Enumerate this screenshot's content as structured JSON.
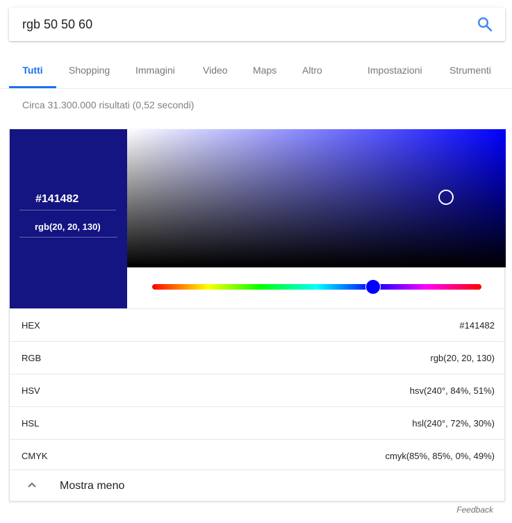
{
  "search": {
    "query": "rgb 50 50 60",
    "icon": "search-icon"
  },
  "tabs": [
    {
      "label": "Tutti",
      "active": true
    },
    {
      "label": "Shopping"
    },
    {
      "label": "Immagini"
    },
    {
      "label": "Video"
    },
    {
      "label": "Maps"
    },
    {
      "label": "Altro"
    },
    {
      "label": "Impostazioni"
    },
    {
      "label": "Strumenti"
    }
  ],
  "results_count": "Circa 31.300.000 risultati (0,52 secondi)",
  "picker": {
    "color": "#141482",
    "hex_display": "#141482",
    "rgb_display": "rgb(20, 20, 130)",
    "hue_color": "#0000ff",
    "hue_degrees": 240
  },
  "values": [
    {
      "key": "HEX",
      "value": "#141482"
    },
    {
      "key": "RGB",
      "value": "rgb(20, 20, 130)"
    },
    {
      "key": "HSV",
      "value": "hsv(240°, 84%, 51%)"
    },
    {
      "key": "HSL",
      "value": "hsl(240°, 72%, 30%)"
    },
    {
      "key": "CMYK",
      "value": "cmyk(85%, 85%, 0%, 49%)"
    }
  ],
  "toggle": {
    "label": "Mostra meno",
    "icon": "chevron-up-icon"
  },
  "feedback": "Feedback",
  "accent": "#1a73e8"
}
